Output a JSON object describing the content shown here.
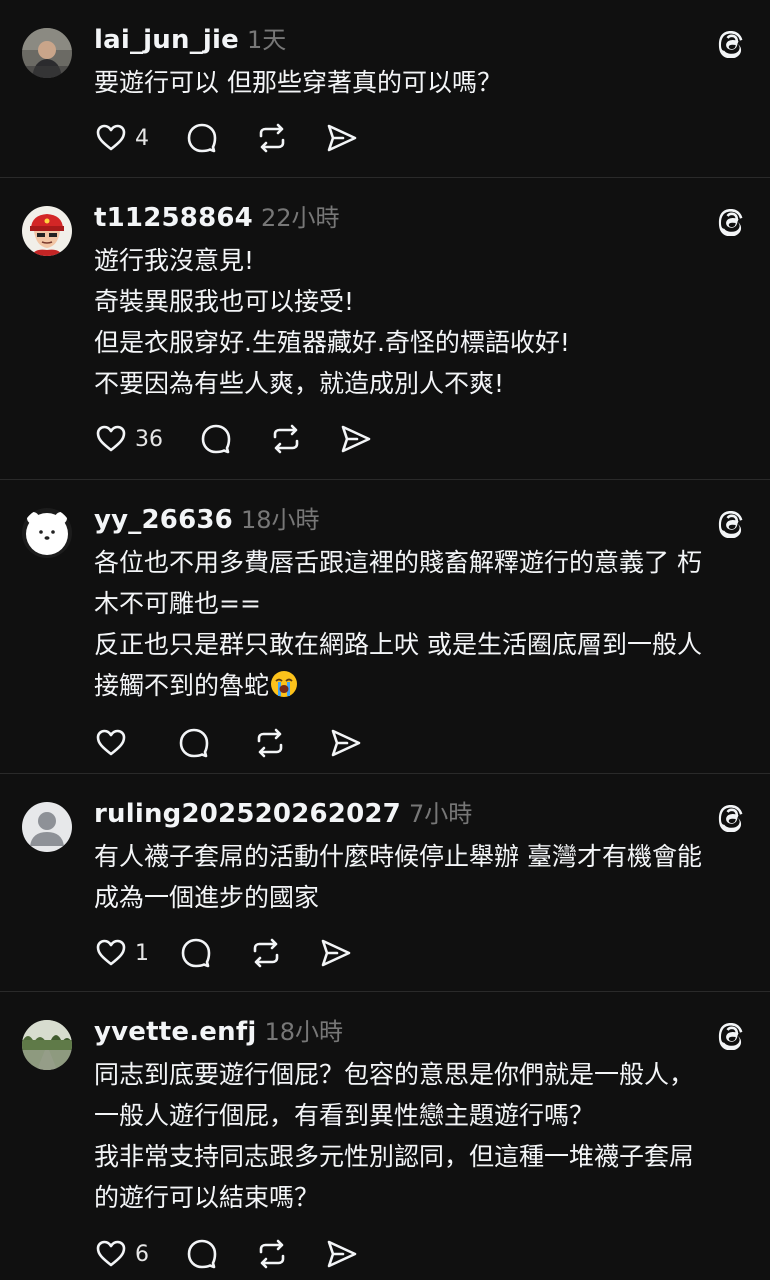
{
  "posts": [
    {
      "username": "lai_jun_jie",
      "time": "1天",
      "avatar": "photo-person-avatar",
      "lines": [
        "要遊行可以 但那些穿著真的可以嗎？"
      ],
      "likes": "4"
    },
    {
      "username": "t11258864",
      "time": "22小時",
      "avatar": "red-cap-cartoon-avatar",
      "lines": [
        "遊行我沒意見!",
        "奇裝異服我也可以接受!",
        "但是衣服穿好.生殖器藏好.奇怪的標語收好!",
        "不要因為有些人爽，就造成別人不爽!"
      ],
      "likes": "36"
    },
    {
      "username": "yy_26636",
      "time": "18小時",
      "avatar": "white-bear-avatar",
      "lines": [
        "各位也不用多費唇舌跟這裡的賤畜解釋遊行的意義了 朽",
        "木不可雕也==",
        "反正也只是群只敢在網路上吠 或是生活圈底層到一般人",
        "接觸不到的魯蛇"
      ],
      "emoji": "loudly-crying-face-emoji",
      "likes": ""
    },
    {
      "username": "ruling202520262027",
      "time": "7小時",
      "avatar": "default-user-avatar",
      "lines": [
        "有人襪子套屌的活動什麼時候停止舉辦 臺灣才有機會能",
        "成為一個進步的國家"
      ],
      "likes": "1"
    },
    {
      "username": "yvette.enfj",
      "time": "18小時",
      "avatar": "street-photo-avatar",
      "lines": [
        "同志到底要遊行個屁？包容的意思是你們就是一般人，",
        "一般人遊行個屁，有看到異性戀主題遊行嗎？",
        "我非常支持同志跟多元性別認同，但這種一堆襪子套屌",
        "的遊行可以結束嗎？"
      ],
      "likes": "6"
    }
  ],
  "icons": {
    "like": "heart-icon",
    "reply": "comment-icon",
    "repost": "repost-icon",
    "share": "send-icon",
    "brand": "threads-logo-icon"
  },
  "colors": {
    "background": "#101010",
    "text": "#f3f5f7",
    "muted": "#777777",
    "divider": "#2a2a2a"
  }
}
